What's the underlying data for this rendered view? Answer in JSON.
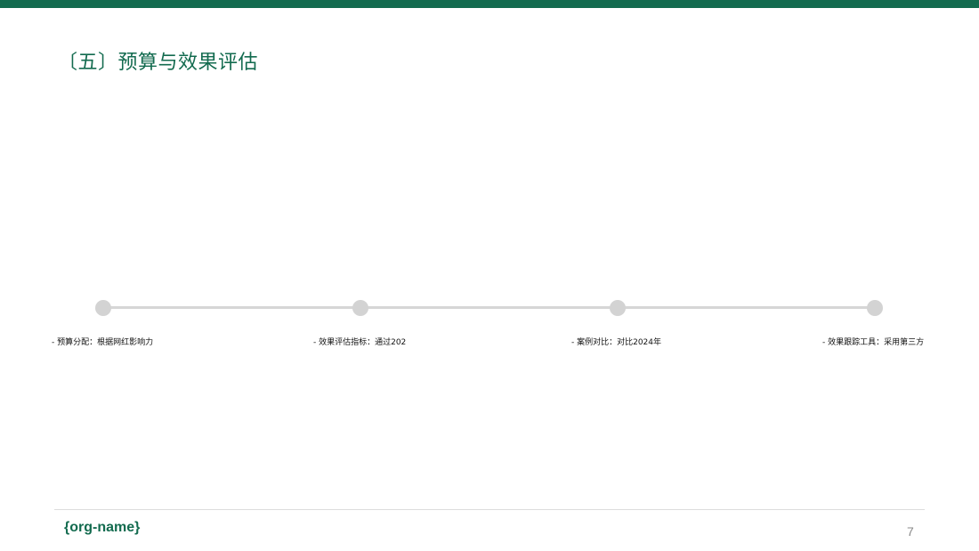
{
  "slide": {
    "title": "〔五〕预算与效果评估",
    "accent_color": "#136b4f"
  },
  "timeline": {
    "line_color": "#d6d6d6",
    "dot_color": "#d3d3d3",
    "items": [
      {
        "label": "- 预算分配：根据网红影响力"
      },
      {
        "label": "- 效果评估指标：通过202"
      },
      {
        "label": "- 案例对比：对比2024年"
      },
      {
        "label": "- 效果跟踪工具：采用第三方"
      }
    ]
  },
  "footer": {
    "org_name": "{org-name}",
    "page_number": "7"
  }
}
